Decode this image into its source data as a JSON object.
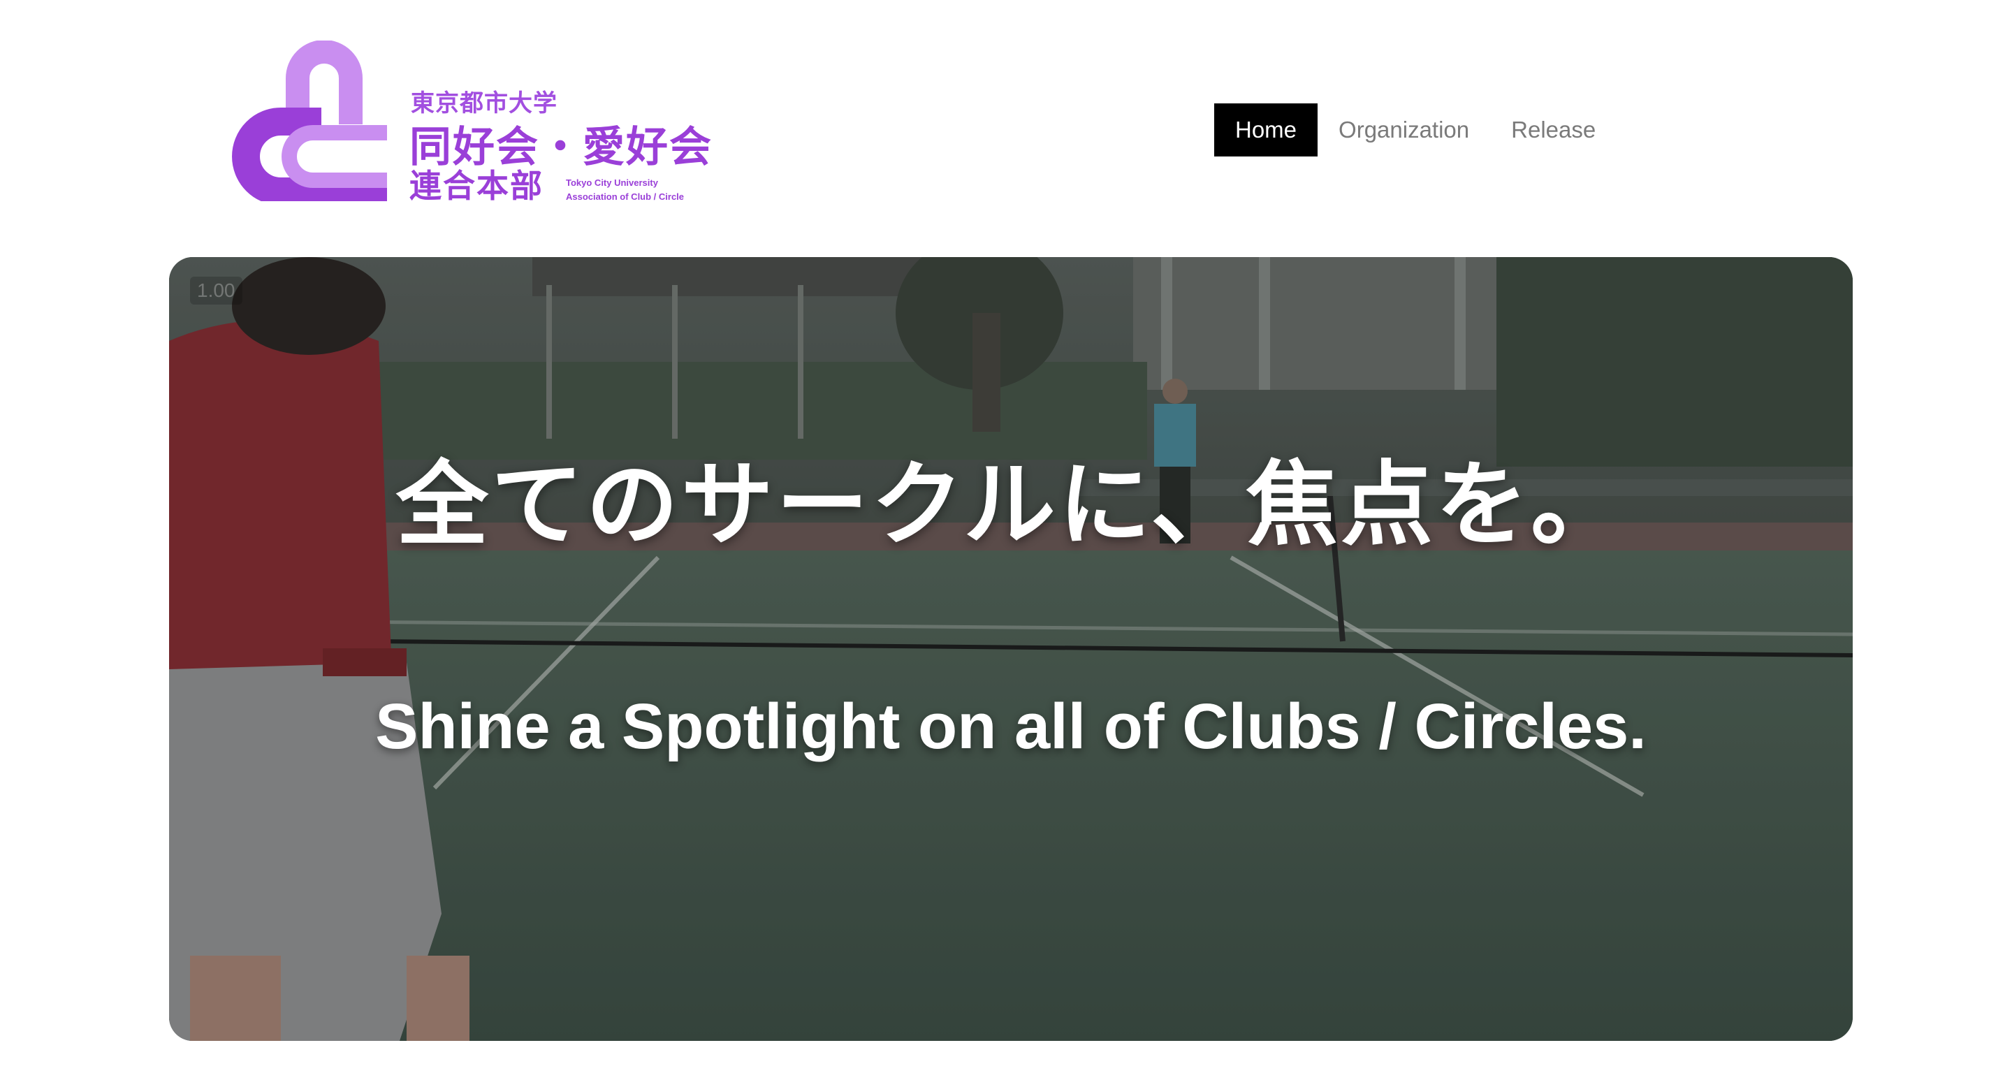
{
  "logo": {
    "jp_top": "東京都市大学",
    "jp_main": "同好会・愛好会",
    "jp_sub": "連合本部",
    "en_line1": "Tokyo City University",
    "en_line2": "Association of Club / Circle",
    "colors": {
      "primary": "#9a3fd8",
      "light": "#c98ef0"
    }
  },
  "nav": {
    "items": [
      {
        "label": "Home",
        "active": true
      },
      {
        "label": "Organization",
        "active": false
      },
      {
        "label": "Release",
        "active": false
      }
    ]
  },
  "hero": {
    "playback_speed": "1.00",
    "title_jp": "全てのサークルに、焦点を。",
    "title_en": "Shine a Spotlight on all of Clubs / Circles."
  }
}
